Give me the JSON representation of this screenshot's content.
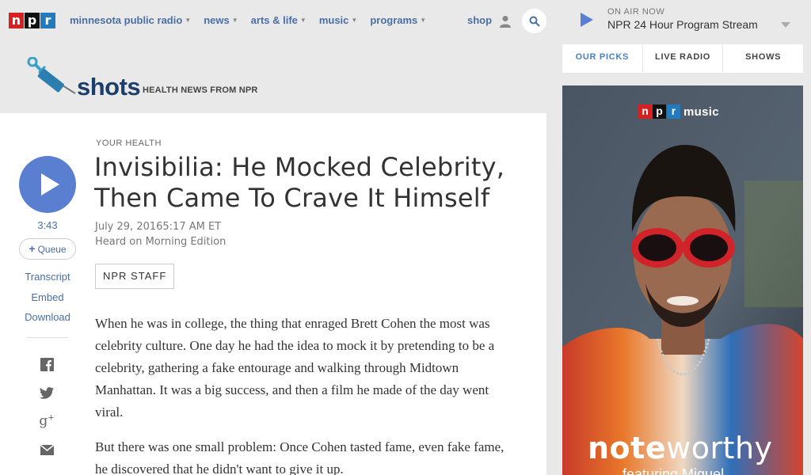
{
  "nav": {
    "logo_letters": [
      "n",
      "p",
      "r"
    ],
    "links": [
      {
        "label": "minnesota public radio"
      },
      {
        "label": "news"
      },
      {
        "label": "arts & life"
      },
      {
        "label": "music"
      },
      {
        "label": "programs"
      }
    ],
    "shop_label": "shop",
    "user_icon": "user-icon",
    "search_icon": "search-icon"
  },
  "shots": {
    "wordmark": "shots",
    "tagline": "HEALTH NEWS FROM NPR",
    "icon": "syringe-icon"
  },
  "audio": {
    "play_icon": "play-icon",
    "duration": "3:43",
    "queue_label": "Queue",
    "links": [
      "Transcript",
      "Embed",
      "Download"
    ]
  },
  "share_icons": [
    "facebook-icon",
    "twitter-icon",
    "google-plus-icon",
    "email-icon"
  ],
  "article": {
    "slug": "YOUR HEALTH",
    "headline": "Invisibilia: He Mocked Celebrity, Then Came To Crave It Himself",
    "date": "July 29, 20165:17 AM ET",
    "heard_on": "Heard on Morning Edition",
    "byline": "NPR STAFF",
    "paragraphs": [
      "When he was in college, the thing that enraged Brett Cohen the most was celebrity culture. One day he had the idea to mock it by pretending to be a celebrity, gathering a fake entourage and walking through Midtown Manhattan. It was a big success, and then a film he made of the day went viral.",
      "But there was one small problem: Once Cohen tasted fame, even fake fame, he discovered that he didn't want to give it up."
    ]
  },
  "on_air": {
    "label": "ON AIR NOW",
    "title": "NPR 24 Hour Program Stream"
  },
  "tabs": [
    {
      "label": "OUR PICKS",
      "active": true
    },
    {
      "label": "LIVE RADIO",
      "active": false
    },
    {
      "label": "SHOWS",
      "active": false
    }
  ],
  "ad": {
    "logo_letters": [
      "n",
      "p",
      "r"
    ],
    "logo_word": "music",
    "headline_bold": "note",
    "headline_rest": "worthy",
    "featuring": "featuring Miguel"
  },
  "colors": {
    "link_blue": "#4a6fa5",
    "play_blue": "#5a7fd1",
    "npr_red": "#d62021",
    "npr_blue": "#237bbd",
    "active_tab": "#4a7fc1"
  }
}
